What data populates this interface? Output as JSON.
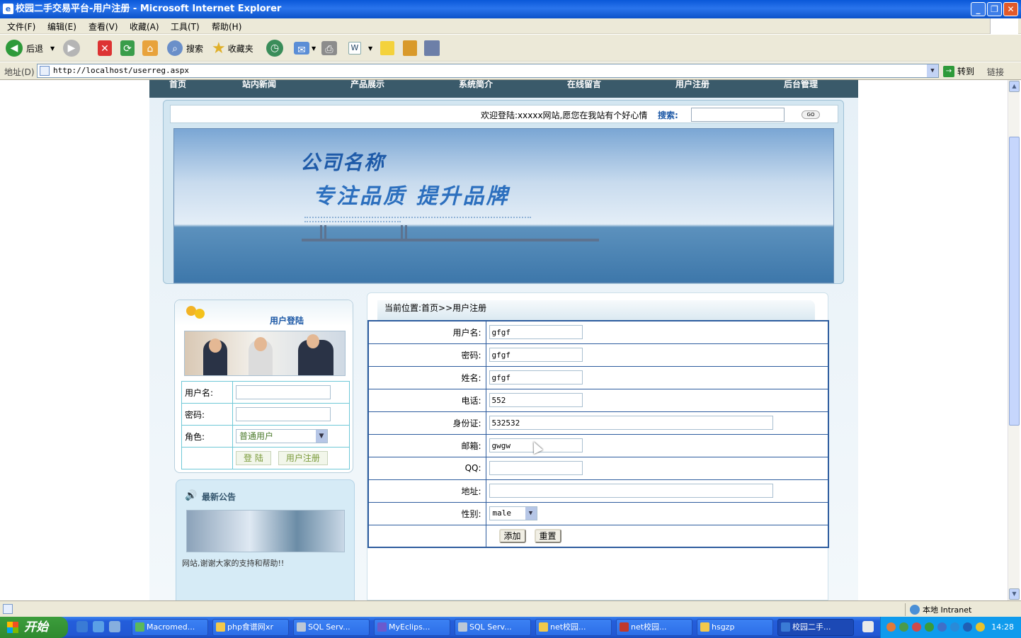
{
  "window": {
    "title": "校园二手交易平台-用户注册 - Microsoft Internet Explorer"
  },
  "menu": [
    "文件(F)",
    "编辑(E)",
    "查看(V)",
    "收藏(A)",
    "工具(T)",
    "帮助(H)"
  ],
  "toolbar": {
    "back": "后退",
    "search": "搜索",
    "favorites": "收藏夹"
  },
  "address": {
    "label": "地址(D)",
    "url": "http://localhost/userreg.aspx",
    "go": "转到",
    "links": "链接"
  },
  "site": {
    "nav": [
      "首页",
      "站内新闻",
      "产品展示",
      "系统简介",
      "在线留言",
      "用户注册",
      "后台管理"
    ],
    "welcome": "欢迎登陆:xxxxx网站,愿您在我站有个好心情",
    "search_label": "搜索:",
    "search_go": "GO",
    "banner_line1": "公司名称",
    "banner_line2": "专注品质 提升品牌",
    "login": {
      "title": "用户登陆",
      "username_label": "用户名:",
      "password_label": "密码:",
      "role_label": "角色:",
      "role_value": "普通用户",
      "login_btn": "登 陆",
      "register_btn": "用户注册"
    },
    "notice": {
      "title": "最新公告",
      "text": "网站,谢谢大家的支持和帮助!!"
    },
    "breadcrumb": "当前位置:首页>>用户注册",
    "form": {
      "fields": [
        {
          "label": "用户名:",
          "value": "gfgf"
        },
        {
          "label": "密码:",
          "value": "gfgf"
        },
        {
          "label": "姓名:",
          "value": "gfgf"
        },
        {
          "label": "电话:",
          "value": "552"
        },
        {
          "label": "身份证:",
          "value": "532532"
        },
        {
          "label": "邮箱:",
          "value": "gwgw"
        },
        {
          "label": "QQ:",
          "value": ""
        },
        {
          "label": "地址:",
          "value": ""
        }
      ],
      "gender_label": "性别:",
      "gender_value": "male",
      "add_btn": "添加",
      "reset_btn": "重置"
    }
  },
  "status": {
    "zone": "本地 Intranet"
  },
  "taskbar": {
    "start": "开始",
    "tasks": [
      "Macromed...",
      "php食谱网xr",
      "SQL Serv...",
      "MyEclips...",
      "SQL Serv...",
      "net校园...",
      "net校园...",
      "hsgzp",
      "校园二手..."
    ],
    "clock": "14:28"
  }
}
